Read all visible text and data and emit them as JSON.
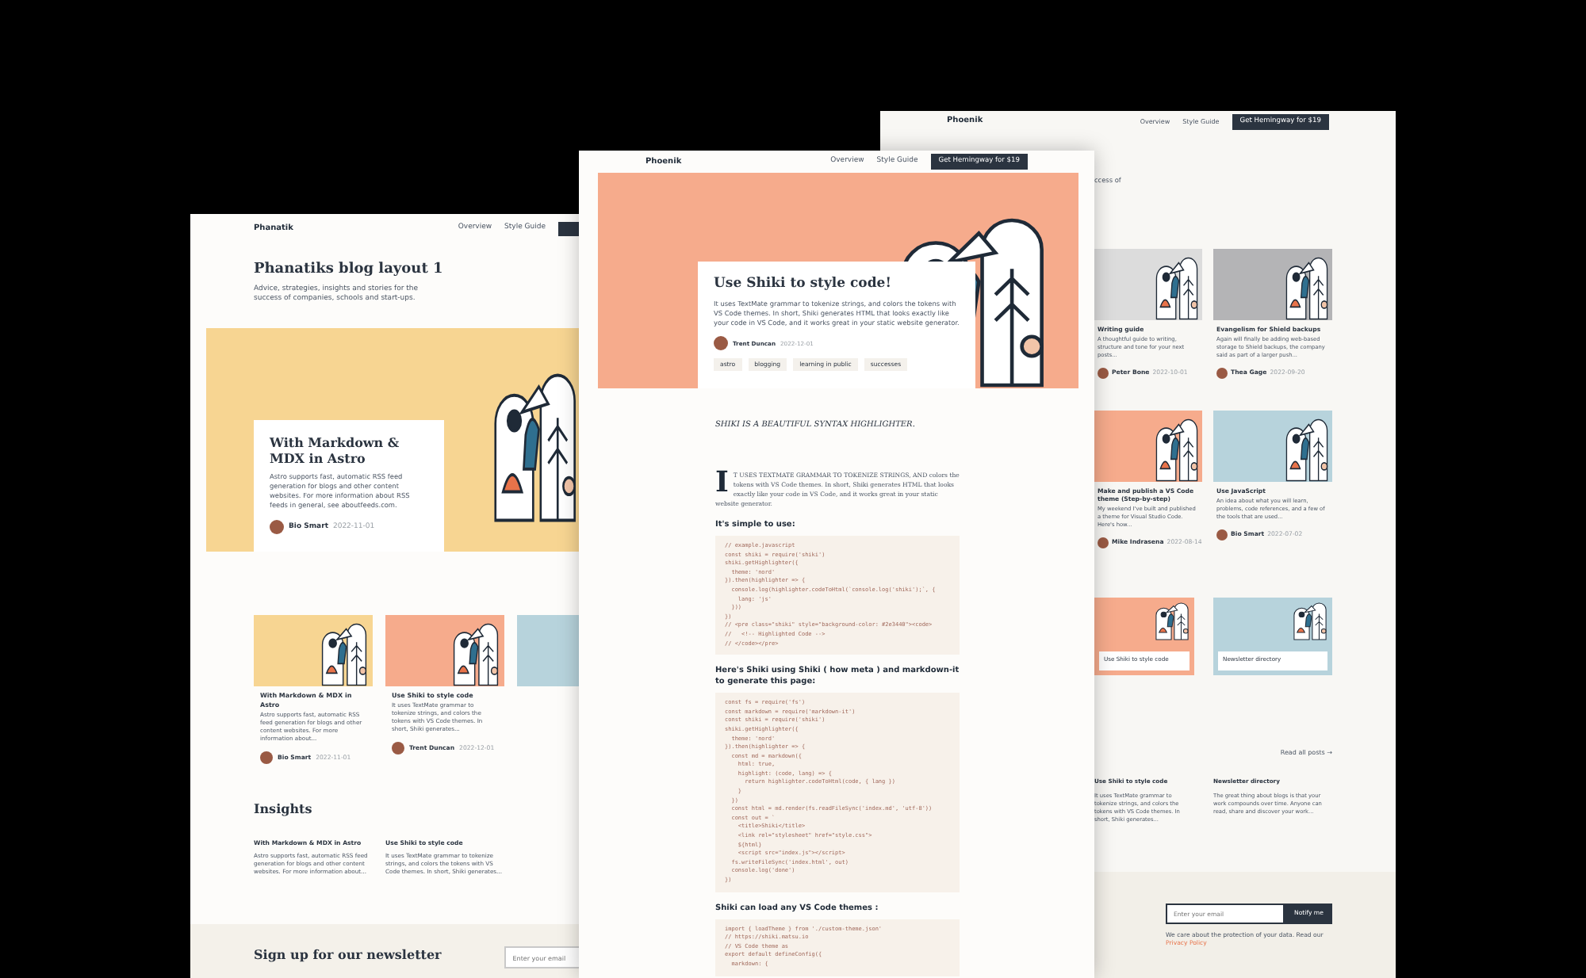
{
  "left_page": {
    "logo": "Phanatik",
    "nav_links": [
      "Overview",
      "Style Guide"
    ],
    "title": "Phanatiks blog layout 1",
    "subtitle": "Advice, strategies, insights and stories for the success of companies, schools and start-ups.",
    "hero": {
      "title": "With Markdown & MDX in Astro",
      "excerpt": "Astro supports fast, automatic RSS feed generation for blogs and other content websites. For more information about RSS feeds in general, see aboutfeeds.com.",
      "author": "Bio Smart",
      "date": "2022-11-01",
      "color": "#f7d592"
    },
    "cards": [
      {
        "title": "With Markdown & MDX in Astro",
        "excerpt": "Astro supports fast, automatic RSS feed generation for blogs and other content websites. For more information about...",
        "author": "Bio Smart",
        "date": "2022-11-01",
        "color": "#f7d592"
      },
      {
        "title": "Use Shiki to style code",
        "excerpt": "It uses TextMate grammar to tokenize strings, and colors the tokens with VS Code themes. In short, Shiki generates...",
        "author": "Trent Duncan",
        "date": "2022-12-01",
        "color": "#f6ab8c"
      },
      {
        "color": "#b7d3dc"
      }
    ],
    "insights_title": "Insights",
    "insights": [
      {
        "title": "With Markdown & MDX in Astro",
        "excerpt": "Astro supports fast, automatic RSS feed generation for blogs and other content websites. For more information about..."
      },
      {
        "title": "Use Shiki to style code",
        "excerpt": "It uses TextMate grammar to tokenize strings, and colors the tokens with VS Code themes. In short, Shiki generates..."
      }
    ],
    "newsletter": {
      "title": "Sign up for our newsletter",
      "placeholder": "Enter your email"
    }
  },
  "front_page": {
    "logo": "Phoenik",
    "nav_links": [
      "Overview",
      "Style Guide"
    ],
    "cta": "Get Hemingway for $19",
    "post": {
      "title": "Use Shiki to style code!",
      "excerpt": "It uses TextMate grammar to tokenize strings, and colors the tokens with VS Code themes. In short, Shiki generates HTML that looks exactly like your code in VS Code, and it works great in your static website generator.",
      "author": "Trent Duncan",
      "date": "2022-12-01",
      "color": "#f6ab8c",
      "tags": [
        "astro",
        "blogging",
        "learning in public",
        "successes"
      ]
    },
    "lead": "SHIKI IS A BEAUTIFUL SYNTAX HIGHLIGHTER.",
    "body": "IT USES TEXTMATE GRAMMAR TO TOKENIZE STRINGS, AND colors the tokens with VS Code themes. In short, Shiki generates HTML that looks exactly like your code in VS Code, and it works great in your static website generator.",
    "sections": [
      {
        "heading": "It's simple to use:",
        "code": [
          "// example.javascript",
          "const shiki = require('shiki')",
          "shiki.getHighlighter({",
          "  theme: 'nord'",
          "}).then(highlighter => {",
          "  console.log(highlighter.codeToHtml(`console.log('shiki');`, {",
          "    lang: 'js'",
          "  }))",
          "})",
          "// <pre class=\"shiki\" style=\"background-color: #2e3440\"><code>",
          "//   <!-- Highlighted Code -->",
          "// </code></pre>"
        ]
      },
      {
        "heading": "Here's Shiki using Shiki ( how meta ) and markdown-it to generate this page:",
        "code": [
          "const fs = require('fs')",
          "const markdown = require('markdown-it')",
          "const shiki = require('shiki')",
          "shiki.getHighlighter({",
          "  theme: 'nord'",
          "}).then(highlighter => {",
          "  const md = markdown({",
          "    html: true,",
          "    highlight: (code, lang) => {",
          "      return highlighter.codeToHtml(code, { lang })",
          "    }",
          "  })",
          "  const html = md.render(fs.readFileSync('index.md', 'utf-8'))",
          "  const out = `",
          "    <title>Shiki</title>",
          "    <link rel=\"stylesheet\" href=\"style.css\">",
          "    ${html}",
          "    <script src=\"index.js\"></script>",
          "  fs.writeFileSync('index.html', out)",
          "  console.log('done')",
          "})"
        ]
      },
      {
        "heading": "Shiki can load any VS Code themes :",
        "code": [
          "import { loadTheme } from './custom-theme.json'",
          "// https://shiki.matsu.io",
          "// VS Code theme as",
          "export default defineConfig({",
          "  markdown: {"
        ]
      }
    ]
  },
  "right_page": {
    "logo": "Phoenik",
    "nav_links": [
      "Overview",
      "Style Guide"
    ],
    "cta": "Get Hemingway for $19",
    "subtitle_fragment": "ccess of",
    "posts": [
      {
        "title": "Writing guide",
        "excerpt": "A thoughtful guide to writing, structure and tone for your next posts...",
        "author": "Peter Bone",
        "date": "2022-10-01",
        "color": "#dcdcdc"
      },
      {
        "title": "Evangelism for Shield backups",
        "excerpt": "Again will finally be adding web-based storage to Shield backups, the company said as part of a larger push...",
        "author": "Thea Gage",
        "date": "2022-09-20",
        "color": "#b4b4b6"
      },
      {
        "title": "Make and publish a VS Code theme (Step-by-step)",
        "excerpt": "My weekend I've built and published a theme for Visual Studio Code. Here's how...",
        "author": "Mike Indrasena",
        "date": "2022-08-14",
        "color": "#f6ab8c"
      },
      {
        "title": "Use JavaScript",
        "excerpt": "An idea about what you will learn, problems, code references, and a few of the tools that are used...",
        "author": "Bio Smart",
        "date": "2022-07-02",
        "color": "#b7d3dc"
      }
    ],
    "featured": [
      {
        "title": "Use Shiki to style code",
        "color": "#f6ab8c"
      },
      {
        "title": "Newsletter directory",
        "color": "#b7d3dc"
      }
    ],
    "read_all": "Read all posts →",
    "insights": [
      {
        "title": "Use Shiki to style code",
        "excerpt": "It uses TextMate grammar to tokenize strings, and colors the tokens with VS Code themes. In short, Shiki generates..."
      },
      {
        "title": "Newsletter directory",
        "excerpt": "The great thing about blogs is that your work compounds over time. Anyone can read, share and discover your work..."
      }
    ],
    "newsletter": {
      "placeholder": "Enter your email",
      "button": "Notify me",
      "note": "We care about the protection of your data. Read our ",
      "link": "Privacy Policy"
    }
  }
}
